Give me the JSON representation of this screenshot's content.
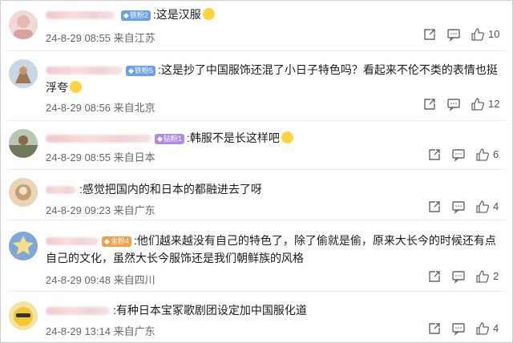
{
  "comments": [
    {
      "badge": "铁粉2",
      "text": ":这是汉服",
      "emoji": "grin-emoji",
      "date": "24-8-29",
      "time": "08:55",
      "location": "来自江苏",
      "likes": "10"
    },
    {
      "badge": "铁粉5",
      "text": ":这是抄了中国服饰还混了小日子特色吗？看起来不伦不类的表情也挺浮夸",
      "emoji": "smile-emoji",
      "date": "24-8-29",
      "time": "08:56",
      "location": "来自北京",
      "likes": "12"
    },
    {
      "badge": "钻粉1",
      "text": ":韩服不是长这样吧",
      "emoji": "think-emoji",
      "date": "24-8-29",
      "time": "08:55",
      "location": "来自日本",
      "likes": "6"
    },
    {
      "badge": "",
      "text": ":感觉把国内的和日本的都融进去了呀",
      "emoji": "",
      "date": "24-8-29",
      "time": "09:23",
      "location": "来自广东",
      "likes": "4"
    },
    {
      "badge": "金粉4",
      "text": ":他们越来越没有自己的特色了，除了偷就是偷，原来大长今的时候还有点自己的文化，虽然大长今服饰还是我们朝鲜族的风格",
      "emoji": "",
      "date": "24-8-29",
      "time": "09:48",
      "location": "来自四川",
      "likes": "2"
    },
    {
      "badge": "",
      "text": ":有种日本宝冢歌剧团设定加中国服化道",
      "emoji": "",
      "date": "24-8-29",
      "time": "13:14",
      "location": "来自广东",
      "likes": "4"
    }
  ],
  "colors": {
    "badge_blue": "#6aa1e6",
    "badge_purple": "#b08be6",
    "badge_orange": "#f0a04a",
    "emoji": "#ffd23f"
  }
}
